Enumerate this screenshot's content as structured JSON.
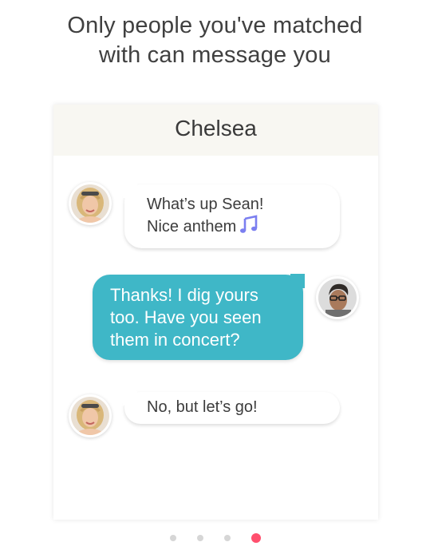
{
  "headline": {
    "line1": "Only people you've matched",
    "line2": "with can message you"
  },
  "conversation": {
    "title": "Chelsea",
    "messages": [
      {
        "sender": "Chelsea",
        "direction": "incoming",
        "line1": "What’s up Sean!",
        "line2": "Nice anthem",
        "icon": "music-note-icon"
      },
      {
        "sender": "Sean",
        "direction": "outgoing",
        "line1": "Thanks! I dig yours",
        "line2": "too. Have you seen",
        "line3": "them in concert?"
      },
      {
        "sender": "Chelsea",
        "direction": "incoming",
        "line1": "No, but let’s go!"
      }
    ]
  },
  "pagination": {
    "total": 4,
    "active_index": 4
  },
  "colors": {
    "outgoing_bubble": "#3fb7c7",
    "active_dot": "#ff4f6d",
    "inactive_dot": "#d6d6d6",
    "music_icon": "#7b7ff0"
  }
}
